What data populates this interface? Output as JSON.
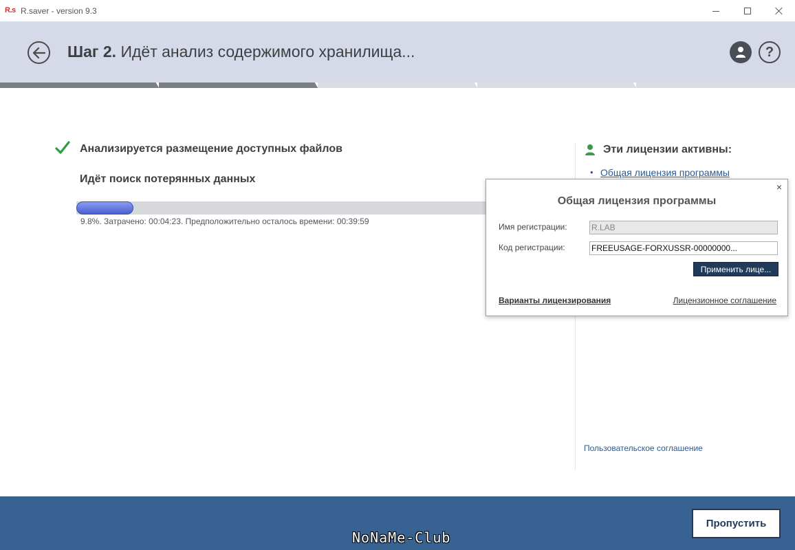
{
  "window": {
    "logo": "R.s",
    "title": "R.saver - version 9.3"
  },
  "header": {
    "step_prefix": "Шаг 2.",
    "step_text": "Идёт анализ содержимого хранилища..."
  },
  "steps": {
    "total": 5,
    "done": 2
  },
  "main": {
    "status_done": "Анализируется размещение доступных файлов",
    "status_current": "Идёт поиск потерянных данных",
    "progress_percent": 9.8,
    "progress_text": "9.8%. Затрачено: 00:04:23. Предположительно осталось времени: 00:39:59"
  },
  "licenses": {
    "title": "Эти лицензии активны:",
    "items": [
      "Общая лицензия программы"
    ],
    "user_agreement": "Пользовательское соглашение"
  },
  "popup": {
    "title": "Общая лицензия программы",
    "name_label": "Имя регистрации:",
    "name_value": "R.LAB",
    "code_label": "Код регистрации:",
    "code_value": "FREEUSAGE-FORXUSSR-00000000...",
    "apply_label": "Применить лице...",
    "variants_link": "Варианты лицензирования",
    "agreement_link": "Лицензионное соглашение",
    "close_glyph": "×"
  },
  "footer": {
    "watermark": "NoNaMe-Club",
    "skip_label": "Пропустить"
  },
  "colors": {
    "header_bg": "#d6dae8",
    "footer_bg": "#376292",
    "accent_dark": "#1f3a5b",
    "check_green": "#2e9e3e",
    "link_blue": "#26599a"
  }
}
